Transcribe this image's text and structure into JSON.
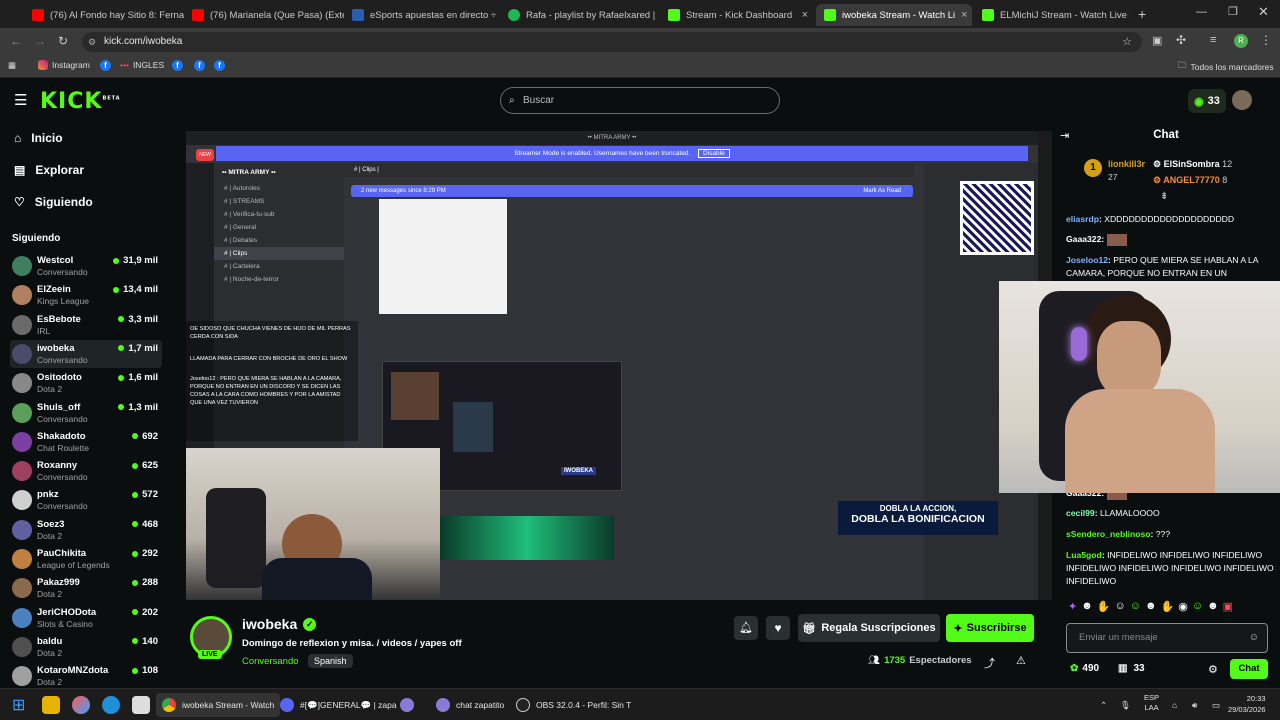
{
  "browser": {
    "tabs": [
      {
        "label": "(76) Al Fondo hay Sitio 8: Ferna",
        "color": "#ff0000"
      },
      {
        "label": "(76) Marianela (Que Pasa) (Exte",
        "color": "#ff0000"
      },
      {
        "label": "eSports apuestas en directo ÷",
        "color": "#2a5db0"
      },
      {
        "label": "Rafa - playlist by Rafaelxared |",
        "color": "#1db954"
      },
      {
        "label": "Stream - Kick Dashboard",
        "color": "#53fc18"
      },
      {
        "label": "iwobeka Stream - Watch Li",
        "color": "#53fc18"
      },
      {
        "label": "ELMichiJ Stream - Watch Live c",
        "color": "#53fc18"
      }
    ],
    "url": "kick.com/iwobeka",
    "bookmarks": [
      "Instagram",
      "INGLES"
    ],
    "all_bookmarks": "Todos los marcadores"
  },
  "header": {
    "logo": "KICK",
    "beta": "BETA",
    "search_placeholder": "Buscar",
    "kicks": "33"
  },
  "sidebar": {
    "nav": [
      {
        "label": "Inicio",
        "icon": "home-icon"
      },
      {
        "label": "Explorar",
        "icon": "compass-icon"
      },
      {
        "label": "Siguiendo",
        "icon": "heart-icon"
      }
    ],
    "following_title": "Siguiendo",
    "channels": [
      {
        "name": "Westcol",
        "category": "Conversando",
        "viewers": "31,9 mil",
        "color": "#3f7f5f"
      },
      {
        "name": "ElZeein",
        "category": "Kings League",
        "viewers": "13,4 mil",
        "color": "#b08060"
      },
      {
        "name": "EsBebote",
        "category": "IRL",
        "viewers": "3,3 mil",
        "color": "#6a6a6a"
      },
      {
        "name": "iwobeka",
        "category": "Conversando",
        "viewers": "1,7 mil",
        "color": "#4a4a6a"
      },
      {
        "name": "Ositodoto",
        "category": "Dota 2",
        "viewers": "1,6 mil",
        "color": "#888888"
      },
      {
        "name": "Shuls_off",
        "category": "Conversando",
        "viewers": "1,3 mil",
        "color": "#5aa05a"
      },
      {
        "name": "Shakadoto",
        "category": "Chat Roulette",
        "viewers": "692",
        "color": "#7a3fa0"
      },
      {
        "name": "Roxanny",
        "category": "Conversando",
        "viewers": "625",
        "color": "#a04060"
      },
      {
        "name": "pnkz",
        "category": "Conversando",
        "viewers": "572",
        "color": "#cfcfcf"
      },
      {
        "name": "Soez3",
        "category": "Dota 2",
        "viewers": "468",
        "color": "#6060a0"
      },
      {
        "name": "PauChikita",
        "category": "League of Legends",
        "viewers": "292",
        "color": "#c08040"
      },
      {
        "name": "Pakaz999",
        "category": "Dota 2",
        "viewers": "288",
        "color": "#8a6a4a"
      },
      {
        "name": "JeriCHODota",
        "category": "Slots & Casino",
        "viewers": "202",
        "color": "#4a80c0"
      },
      {
        "name": "baldu",
        "category": "Dota 2",
        "viewers": "140",
        "color": "#505050"
      },
      {
        "name": "KotaroMNZdota",
        "category": "Dota 2",
        "viewers": "108",
        "color": "#a0a0a0"
      }
    ]
  },
  "player": {
    "discord_banner": "Streamer Mode is enabled. Usernames have been truncated.",
    "discord_disable": "Disable",
    "discord_title": "MITRA ARMY",
    "discord_new_messages": "2 new messages since 8:29 PM",
    "discord_mark_read": "Mark As Read",
    "discord_channels": [
      "Autoroles",
      "STREAMS",
      "Verifica-tu-sub",
      "General",
      "Debates",
      "Clips",
      "Cartelera",
      "Noche-de-terror"
    ],
    "overlay_chat": [
      "OE SIDOSO QUE CHUCHA VIENES DE HIJO DE MIL PERRAS CERDA CON SIDA",
      "LLAMADA PARA CERRAR CON BROCHE DE ORO EL SHOW",
      "Joseloo12 : PERO QUE MIERA SE HABLAN A LA CAMARA, PORQUE NO ENTRAN EN UN DISCORD Y SE DICEN LAS COSAS A LA CARA COMO HOMBRES Y POR LA AMISTAD QUE UNA VEZ TUVIERON"
    ],
    "promo_line1": "DOBLA LA ACCION,",
    "promo_line2": "DOBLA LA BONIFICACION"
  },
  "stream": {
    "streamer": "iwobeka",
    "live": "LIVE",
    "title": "Domingo de reflexion y misa.  /  videos / yapes off",
    "category": "Conversando",
    "language": "Spanish",
    "viewers": "1735",
    "viewers_label": "Espectadores",
    "gift_label": "Regala Suscripciones",
    "subscribe_label": "Suscribirse"
  },
  "chat": {
    "title": "Chat",
    "gifters": [
      {
        "rank": "1",
        "name": "lionkill3r",
        "count": "27"
      },
      {
        "rank": "",
        "name": "ElSinSombra",
        "count": "12"
      },
      {
        "rank": "",
        "name": "ANGEL77770",
        "count": "8"
      }
    ],
    "messages": [
      {
        "user": "eliasrdp",
        "color": "#7fb3ff",
        "text": "XDDDDDDDDDDDDDDDDDDDD"
      },
      {
        "user": "Gaaa322",
        "color": "#ffffff",
        "text": ""
      },
      {
        "user": "Joseloo12",
        "color": "#7fb3ff",
        "text": "PERO QUE MIERA SE HABLAN A LA CAMARA, PORQUE NO ENTRAN EN UN"
      },
      {
        "user": "Gaaa322",
        "color": "#ffffff",
        "text": ""
      },
      {
        "user": "cecil99",
        "color": "#7fffb3",
        "text": "LLAMALOOOO"
      },
      {
        "user": "sSendero_neblinoso",
        "color": "#53fc18",
        "text": "???"
      },
      {
        "user": "Lua5god",
        "color": "#53fc18",
        "text": "INFIDELIWO INFIDELIWO INFIDELIWO INFIDELIWO INFIDELIWO INFIDELIWO INFIDELIWO INFIDELIWO"
      }
    ],
    "input_placeholder": "Enviar un mensaje",
    "points": "490",
    "kicks": "33",
    "send_label": "Chat"
  },
  "taskbar": {
    "items": [
      "iwobeka Stream - Watch",
      "#[💬]GENERAL💬 | zapa",
      "chat zapatito",
      "OBS 32.0.4 - Perfil: Sin T"
    ],
    "lang": "ESP",
    "lang2": "LAA",
    "time": "20:33",
    "date": "29/03/2026"
  }
}
